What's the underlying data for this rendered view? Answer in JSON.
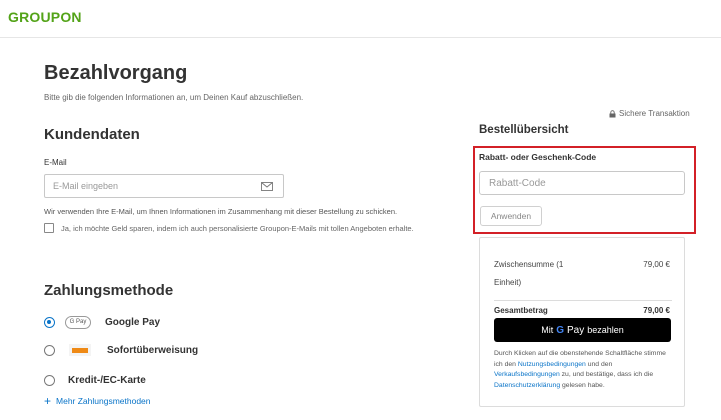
{
  "brand": {
    "logo_text": "GROUPON",
    "accent": "#53a318"
  },
  "page": {
    "title": "Bezahlvorgang",
    "subtitle": "Bitte gib die folgenden Informationen an, um Deinen Kauf abzuschließen.",
    "secure_label": "Sichere Transaktion"
  },
  "kundendaten": {
    "title": "Kundendaten",
    "email_label": "E-Mail",
    "email_placeholder": "E-Mail eingeben",
    "email_value": "",
    "email_hint": "Wir verwenden Ihre E-Mail, um Ihnen Informationen im Zusammenhang mit dieser Bestellung zu schicken.",
    "newsletter_label": "Ja, ich möchte Geld sparen, indem ich auch personalisierte Groupon-E-Mails mit tollen Angeboten erhalte.",
    "newsletter_checked": false
  },
  "zahlung": {
    "title": "Zahlungsmethode",
    "gpay_badge": "G Pay",
    "methods": [
      {
        "label": "Google Pay",
        "selected": true
      },
      {
        "label": "Sofortüberweisung",
        "selected": false
      },
      {
        "label": "Kredit-/EC-Karte",
        "selected": false
      }
    ],
    "more_label": "Mehr Zahlungsmethoden",
    "link_color": "#0a74c8"
  },
  "summary": {
    "title": "Bestellübersicht",
    "coupon_label": "Rabatt- oder Geschenk-Code",
    "coupon_placeholder": "Rabatt-Code",
    "apply_label": "Anwenden",
    "highlight_color": "#d32027",
    "subtotal_label": "Zwischensumme (1 Einheit)",
    "subtotal_value": "79,00 €",
    "total_label": "Gesamtbetrag",
    "total_value": "79,00 €",
    "pay_button": {
      "prefix": "Mit",
      "g": "G",
      "pay": "Pay",
      "suffix": "bezahlen"
    },
    "legal": {
      "part1": "Durch Klicken auf die obenstehende Schaltfläche stimme ich den",
      "link1": "Nutzungsbedingungen",
      "part2": "und den",
      "link2": "Verkaufsbedingungen",
      "part3": "zu, und bestätige, dass ich die",
      "link3": "Datenschutzerklärung",
      "part4": "gelesen habe."
    }
  }
}
